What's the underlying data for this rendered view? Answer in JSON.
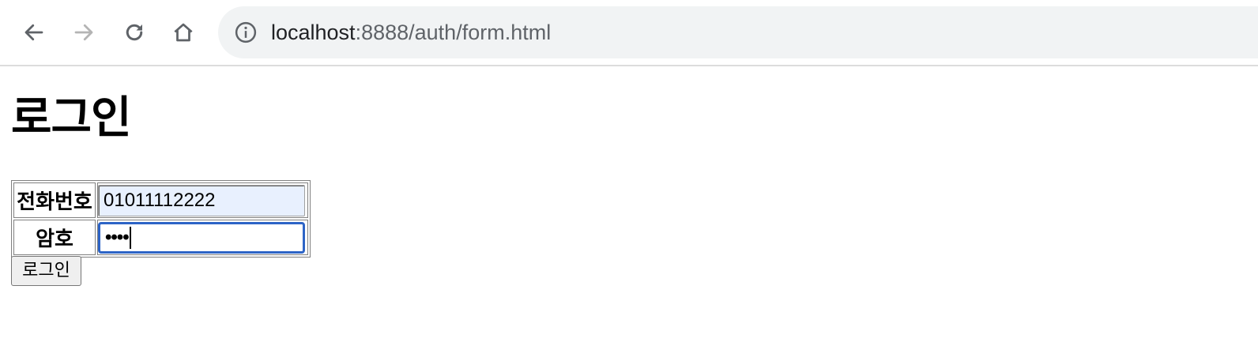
{
  "browser": {
    "url_host": "localhost",
    "url_path": ":8888/auth/form.html",
    "icons": [
      "back-icon",
      "forward-icon",
      "reload-icon",
      "home-icon",
      "site-info-icon"
    ],
    "colors": {
      "omnibox_bg": "#f1f3f4",
      "focus_ring": "#2d64c6",
      "autofill_bg": "#e8f0fe"
    }
  },
  "page": {
    "heading": "로그인",
    "form": {
      "phone_label": "전화번호",
      "phone_value": "01011112222",
      "password_label": "암호",
      "password_masked": "••••",
      "submit_label": "로그인"
    }
  }
}
